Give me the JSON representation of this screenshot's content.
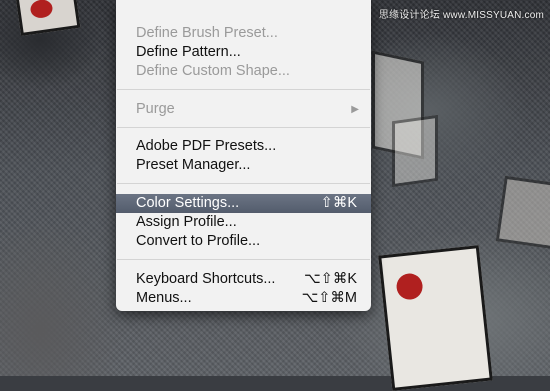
{
  "watermark": "思缘设计论坛 www.MISSYUAN.com",
  "menu": {
    "items": [
      {
        "label": "Define Brush Preset...",
        "disabled": true
      },
      {
        "label": "Define Pattern...",
        "disabled": false
      },
      {
        "label": "Define Custom Shape...",
        "disabled": true
      },
      {
        "label": "Purge",
        "disabled": true,
        "submenu_icon": "▶"
      },
      {
        "label": "Adobe PDF Presets...",
        "disabled": false
      },
      {
        "label": "Preset Manager...",
        "disabled": false
      },
      {
        "label": "Color Settings...",
        "shortcut": "⇧⌘K",
        "selected": true
      },
      {
        "label": "Assign Profile...",
        "disabled": false
      },
      {
        "label": "Convert to Profile...",
        "disabled": false
      },
      {
        "label": "Keyboard Shortcuts...",
        "shortcut": "⌥⇧⌘K"
      },
      {
        "label": "Menus...",
        "shortcut": "⌥⇧⌘M"
      }
    ]
  },
  "colors": {
    "menu_bg": "#f2f2f2",
    "selection": "#5c6575",
    "disabled_text": "#9a9a9a"
  }
}
